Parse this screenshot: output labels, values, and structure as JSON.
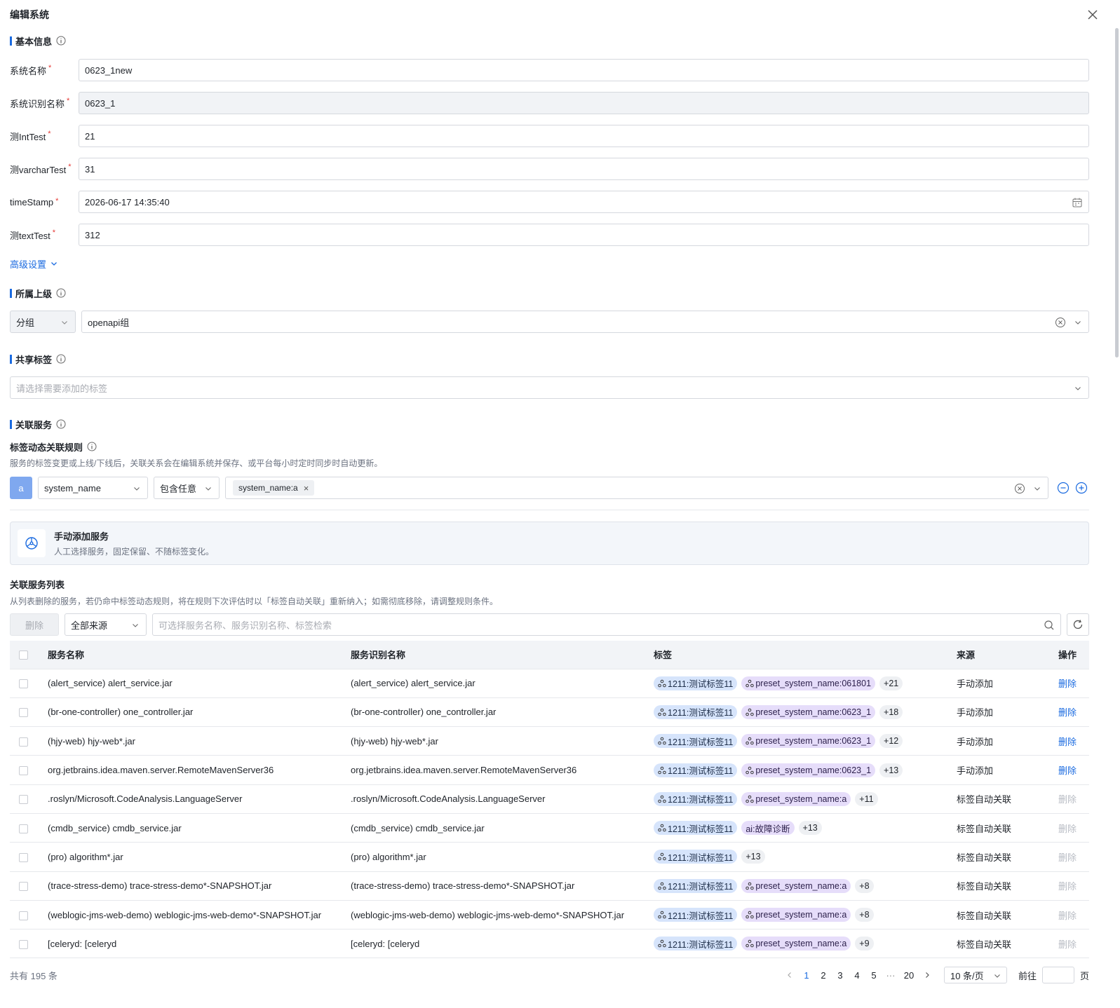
{
  "dialog": {
    "title": "编辑系统"
  },
  "basic": {
    "title": "基本信息",
    "fields": [
      {
        "label": "系统名称",
        "value": "0623_1new"
      },
      {
        "label": "系统识别名称",
        "value": "0623_1"
      },
      {
        "label": "测IntTest",
        "value": "21"
      },
      {
        "label": "测varcharTest",
        "value": "31"
      },
      {
        "label": "timeStamp",
        "value": "2026-06-17 14:35:40"
      },
      {
        "label": "测textTest",
        "value": "312"
      }
    ],
    "required_mark": "*",
    "advanced_label": "高级设置"
  },
  "parent": {
    "title": "所属上级",
    "type_value": "分组",
    "group_value": "openapi组"
  },
  "shared_tags": {
    "title": "共享标签",
    "placeholder": "请选择需要添加的标签"
  },
  "services": {
    "title": "关联服务",
    "rule_title": "标签动态关联规则",
    "rule_desc": "服务的标签变更或上线/下线后，关联关系会在编辑系统并保存、或平台每小时定时同步时自动更新。",
    "rule": {
      "letter": "a",
      "field": "system_name",
      "operator": "包含任意",
      "chip": "system_name:a"
    },
    "manual_title": "手动添加服务",
    "manual_desc": "人工选择服务，固定保留、不随标签变化。",
    "list_title": "关联服务列表",
    "list_desc": "从列表删除的服务，若仍命中标签动态规则，将在规则下次评估时以「标签自动关联」重新纳入；如需彻底移除，请调整规则条件。",
    "toolbar": {
      "delete_label": "删除",
      "source_value": "全部来源",
      "search_placeholder": "可选择服务名称、服务识别名称、标签检索"
    }
  },
  "table": {
    "columns": [
      "服务名称",
      "服务识别名称",
      "标签",
      "来源",
      "操作"
    ],
    "rows": [
      {
        "name": "(alert_service) alert_service.jar",
        "ident": "(alert_service) alert_service.jar",
        "tag1": "1211:测试标签11",
        "tag2": "preset_system_name:061801",
        "tag2_type": "purple",
        "more": "+21",
        "source": "手动添加",
        "op": "删除",
        "op_enabled": true
      },
      {
        "name": "(br-one-controller) one_controller.jar",
        "ident": "(br-one-controller) one_controller.jar",
        "tag1": "1211:测试标签11",
        "tag2": "preset_system_name:0623_1",
        "tag2_type": "purple",
        "more": "+18",
        "source": "手动添加",
        "op": "删除",
        "op_enabled": true
      },
      {
        "name": "(hjy-web) hjy-web*.jar",
        "ident": "(hjy-web) hjy-web*.jar",
        "tag1": "1211:测试标签11",
        "tag2": "preset_system_name:0623_1",
        "tag2_type": "purple",
        "more": "+12",
        "source": "手动添加",
        "op": "删除",
        "op_enabled": true
      },
      {
        "name": "org.jetbrains.idea.maven.server.RemoteMavenServer36",
        "ident": "org.jetbrains.idea.maven.server.RemoteMavenServer36",
        "tag1": "1211:测试标签11",
        "tag2": "preset_system_name:0623_1",
        "tag2_type": "purple",
        "more": "+13",
        "source": "手动添加",
        "op": "删除",
        "op_enabled": true
      },
      {
        "name": ".roslyn/Microsoft.CodeAnalysis.LanguageServer",
        "ident": ".roslyn/Microsoft.CodeAnalysis.LanguageServer",
        "tag1": "1211:测试标签11",
        "tag2": "preset_system_name:a",
        "tag2_type": "purple",
        "more": "+11",
        "source": "标签自动关联",
        "op": "删除",
        "op_enabled": false
      },
      {
        "name": "(cmdb_service) cmdb_service.jar",
        "ident": "(cmdb_service) cmdb_service.jar",
        "tag1": "1211:测试标签11",
        "tag2": "ai:故障诊断",
        "tag2_type": "purple-plain",
        "more": "+13",
        "source": "标签自动关联",
        "op": "删除",
        "op_enabled": false
      },
      {
        "name": "(pro) algorithm*.jar",
        "ident": "(pro) algorithm*.jar",
        "tag1": "1211:测试标签11",
        "tag2": "",
        "tag2_type": "none",
        "more": "+13",
        "source": "标签自动关联",
        "op": "删除",
        "op_enabled": false
      },
      {
        "name": "(trace-stress-demo) trace-stress-demo*-SNAPSHOT.jar",
        "ident": "(trace-stress-demo) trace-stress-demo*-SNAPSHOT.jar",
        "tag1": "1211:测试标签11",
        "tag2": "preset_system_name:a",
        "tag2_type": "purple",
        "more": "+8",
        "source": "标签自动关联",
        "op": "删除",
        "op_enabled": false
      },
      {
        "name": "(weblogic-jms-web-demo) weblogic-jms-web-demo*-SNAPSHOT.jar",
        "ident": "(weblogic-jms-web-demo) weblogic-jms-web-demo*-SNAPSHOT.jar",
        "tag1": "1211:测试标签11",
        "tag2": "preset_system_name:a",
        "tag2_type": "purple",
        "more": "+8",
        "source": "标签自动关联",
        "op": "删除",
        "op_enabled": false
      },
      {
        "name": "[celeryd: [celeryd",
        "ident": "[celeryd: [celeryd",
        "tag1": "1211:测试标签11",
        "tag2": "preset_system_name:a",
        "tag2_type": "purple",
        "more": "+9",
        "source": "标签自动关联",
        "op": "删除",
        "op_enabled": false
      }
    ]
  },
  "pagination": {
    "total": "共有 195 条",
    "pages": [
      "1",
      "2",
      "3",
      "4",
      "5"
    ],
    "ellipsis": "···",
    "last": "20",
    "current": "1",
    "page_size": "10 条/页",
    "goto_label": "前往",
    "page_suffix": "页"
  },
  "colors": {
    "accent": "#1b6be0",
    "tag_blue": "#d6e4fb",
    "tag_purple": "#e6ddfa",
    "required": "#e53935"
  },
  "icons": [
    "close-icon",
    "info-icon",
    "calendar-icon",
    "chevron-down-icon",
    "clear-circle-icon",
    "minus-circle-icon",
    "plus-circle-icon",
    "steering-icon",
    "search-icon",
    "refresh-icon",
    "tag-cluster-icon",
    "chevron-left-icon",
    "chevron-right-icon"
  ]
}
